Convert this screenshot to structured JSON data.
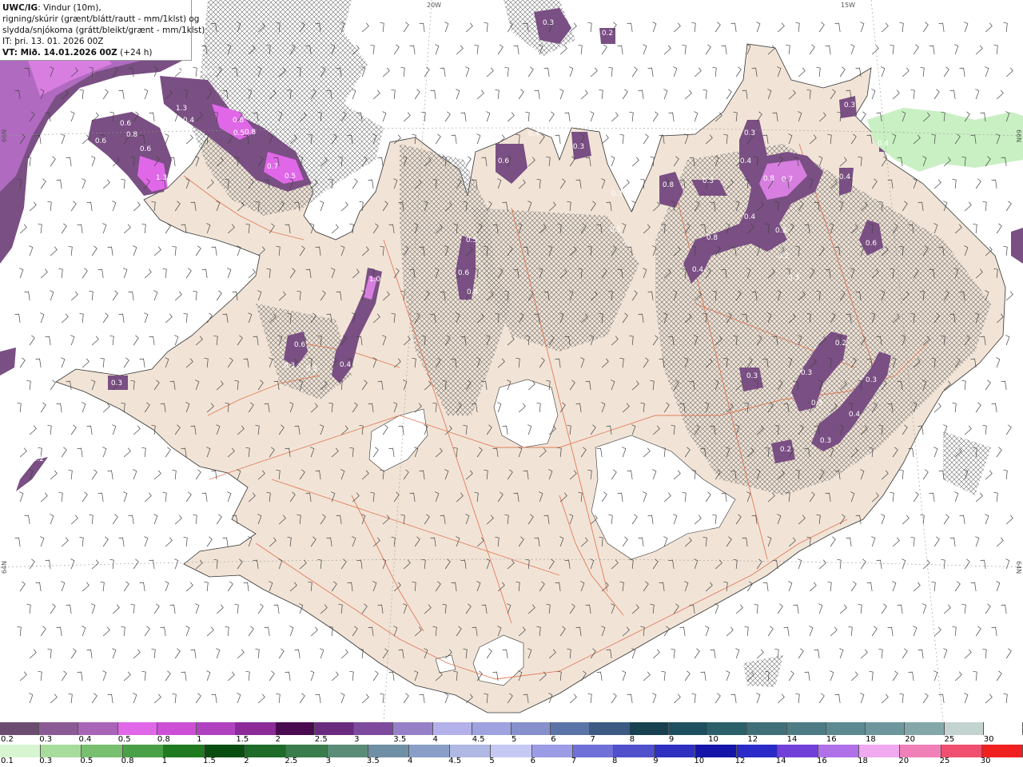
{
  "header": {
    "model": "UWC/IG",
    "line1_rest": ": Vindur (10m),",
    "line2": "rigning/skúrir (grænt/blátt/rautt - mm/1klst) og",
    "line3": "slydda/snjókoma (grátt/bleikt/grænt - mm/1klst)",
    "init_time": "IT: þri. 13. 01. 2026 00Z",
    "valid_time_bold": "VT: Mið. 14.01.2026 00Z",
    "valid_time_rest": " (+24 h)"
  },
  "coordinates": {
    "lon_20w": "20W",
    "lon_15w": "15W",
    "lat_66n_left": "66N",
    "lat_66n_right": "66N",
    "lat_64n_left": "64N",
    "lat_64n_right": "64N"
  },
  "snow_legend": {
    "labels": [
      "0.2",
      "0.3",
      "0.4",
      "0.5",
      "0.8",
      "1",
      "1.5",
      "2",
      "2.5",
      "3",
      "3.5",
      "4",
      "4.5",
      "5",
      "6",
      "7",
      "8",
      "9",
      "10",
      "12",
      "14",
      "16",
      "18",
      "20",
      "25",
      "30"
    ],
    "colors": [
      "#6b4e6f",
      "#8a5a94",
      "#a865b8",
      "#e067e8",
      "#cc4fd6",
      "#b042c0",
      "#8c2a9a",
      "#4a0a50",
      "#6a2a80",
      "#7d4a9e",
      "#9680c8",
      "#b4b0ea",
      "#9ea2de",
      "#8590cc",
      "#5b74a8",
      "#3c5a82",
      "#174050",
      "#1e4f5e",
      "#2b5f6a",
      "#3f6f78",
      "#4e7c84",
      "#5c8a90",
      "#6d979c",
      "#84a8aa",
      "#c3d3cf",
      "#ffffff"
    ]
  },
  "rain_legend": {
    "labels": [
      "0.1",
      "0.3",
      "0.5",
      "0.8",
      "1",
      "1.5",
      "2",
      "2.5",
      "3",
      "3.5",
      "4",
      "4.5",
      "5",
      "6",
      "7",
      "8",
      "9",
      "10",
      "12",
      "14",
      "16",
      "18",
      "20",
      "25",
      "30"
    ],
    "colors": [
      "#d8f5d2",
      "#a8dc9c",
      "#78c070",
      "#4aa046",
      "#1f7a20",
      "#0a4d10",
      "#1e6a28",
      "#3a7c4c",
      "#5a8c78",
      "#6f8fa4",
      "#8a9fc8",
      "#b0b8e4",
      "#c6c8f4",
      "#9c9ce6",
      "#7070d8",
      "#5050cc",
      "#3030c0",
      "#1414a8",
      "#2a2ac8",
      "#7040d8",
      "#b070e8",
      "#f0a8f0",
      "#f080b8",
      "#f05070",
      "#f02020"
    ]
  },
  "map_labels": {
    "values": [
      "0.3",
      "0.2",
      "0.3",
      "0.4",
      "0.5",
      "0.6",
      "0.8",
      "1.3",
      "0.8",
      "0.8",
      "0.7",
      "0.5",
      "0.6",
      "0.6",
      "0.5",
      "0.4",
      "1.3",
      "0.6",
      "0.4",
      "0.3",
      "0.8",
      "0.3",
      "0.4",
      "0.8",
      "0.7",
      "0.4",
      "0.8",
      "0.3",
      "0.4",
      "0.3",
      "0.6",
      "0.4",
      "0.3",
      "0.5",
      "0.3",
      "0.6",
      "0.4",
      "1.0",
      "0.6",
      "0.3",
      "0.5",
      "0.4",
      "0.3",
      "0.4",
      "0.3",
      "0.2",
      "0.3",
      "0.2",
      "0.3",
      "0.3",
      "0.3",
      "0.2",
      "0.5",
      "0.4",
      "0.2"
    ]
  }
}
